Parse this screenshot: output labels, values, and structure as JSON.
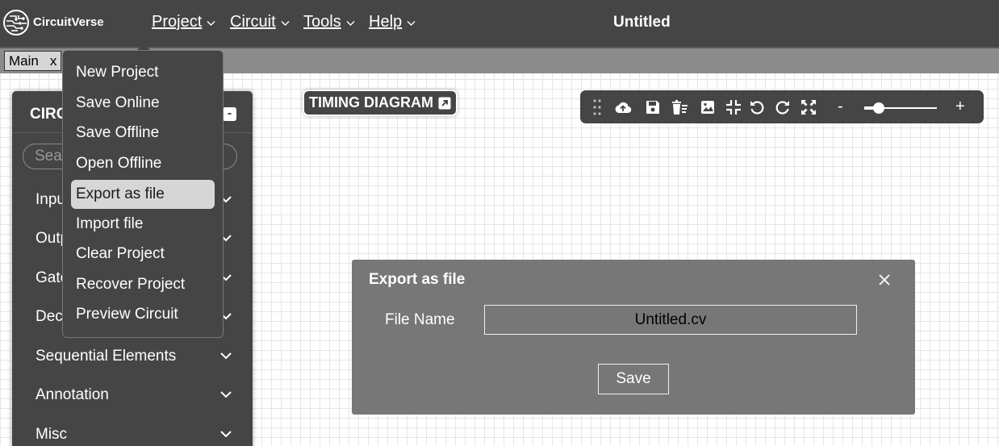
{
  "app": {
    "brand": "CircuitVerse",
    "title": "Untitled"
  },
  "menu": [
    {
      "label": "Project"
    },
    {
      "label": "Circuit"
    },
    {
      "label": "Tools"
    },
    {
      "label": "Help"
    }
  ],
  "tabs": [
    {
      "label": "Main",
      "close": "x"
    }
  ],
  "panel": {
    "title": "CIRCUIT ELEMENTS",
    "minimize": "-",
    "search_placeholder": "Search...",
    "categories": [
      {
        "label": "Input"
      },
      {
        "label": "Output"
      },
      {
        "label": "Gates"
      },
      {
        "label": "Decoders & Plexers"
      },
      {
        "label": "Sequential Elements"
      },
      {
        "label": "Annotation"
      },
      {
        "label": "Misc"
      }
    ]
  },
  "project_menu": {
    "items": [
      {
        "label": "New Project"
      },
      {
        "label": "Save Online"
      },
      {
        "label": "Save Offline"
      },
      {
        "label": "Open Offline"
      },
      {
        "label": "Export as file",
        "active": true
      },
      {
        "label": "Import file"
      },
      {
        "label": "Clear Project"
      },
      {
        "label": "Recover Project"
      },
      {
        "label": "Preview Circuit"
      }
    ]
  },
  "timing_diagram": {
    "label": "TIMING DIAGRAM"
  },
  "toolbar": {
    "icons": [
      "drag-handle-icon",
      "cloud-upload-icon",
      "save-icon",
      "delete-list-icon",
      "image-icon",
      "fit-icon",
      "undo-icon",
      "redo-icon",
      "fullscreen-icon"
    ],
    "zoom_out": "-",
    "zoom_in": "+",
    "zoom_level": 0.2
  },
  "dialog": {
    "title": "Export as file",
    "close": "×",
    "field_label": "File Name",
    "file_name": "Untitled.cv",
    "save_label": "Save"
  },
  "colors": {
    "bar": "#454545",
    "tabstrip": "#8c8c8c",
    "dialog": "#777777",
    "active_item": "#d6d6d6"
  }
}
